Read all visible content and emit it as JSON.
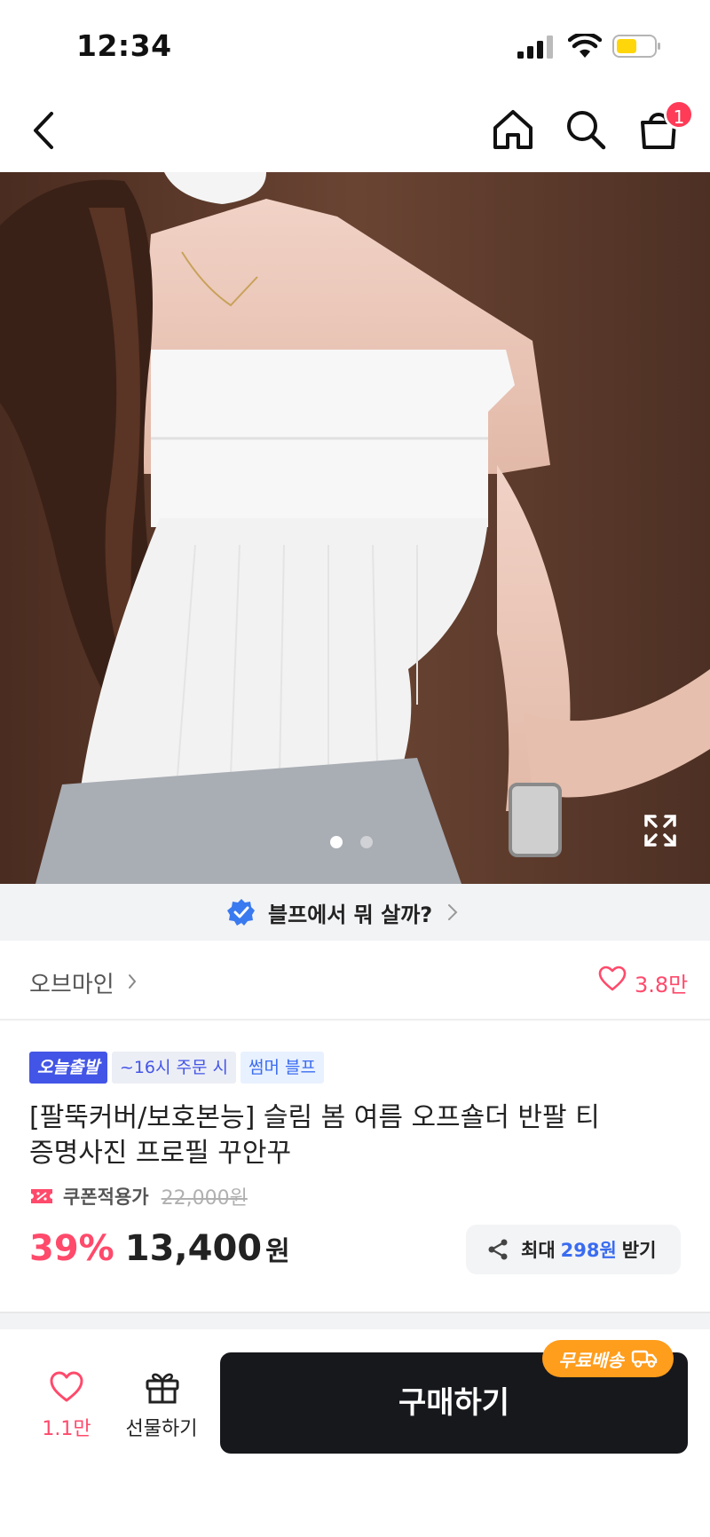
{
  "status_bar": {
    "time": "12:34"
  },
  "nav": {
    "cart_count": "1"
  },
  "product_image": {
    "current_slide": 1,
    "total_slides": 2
  },
  "promo": {
    "text": "블프에서 뭐 살까?"
  },
  "store": {
    "name": "오브마인",
    "likes": "3.8만"
  },
  "tags": {
    "today": "오늘출발",
    "cutoff": "~16시 주문 시",
    "event": "썸머 블프"
  },
  "product": {
    "title_line1": "[팔뚝커버/보호본능] 슬림 봄 여름 오프숄더 반팔 티",
    "title_line2": "증명사진 프로필 꾸안꾸",
    "coupon_label": "쿠폰적용가",
    "original_price": "22,000원",
    "discount": "39%",
    "price": "13,400",
    "price_unit": "원"
  },
  "reward": {
    "pre": "최대",
    "amount": "298원",
    "post": "받기"
  },
  "bottom_bar": {
    "wish_count": "1.1만",
    "gift_label": "선물하기",
    "buy_label": "구매하기",
    "free_shipping": "무료배송"
  },
  "colors": {
    "accent_pink": "#ff4a6b",
    "blue": "#3a6cf0",
    "badge_orange": "#ff9d1c",
    "buy_dark": "#17181c"
  }
}
